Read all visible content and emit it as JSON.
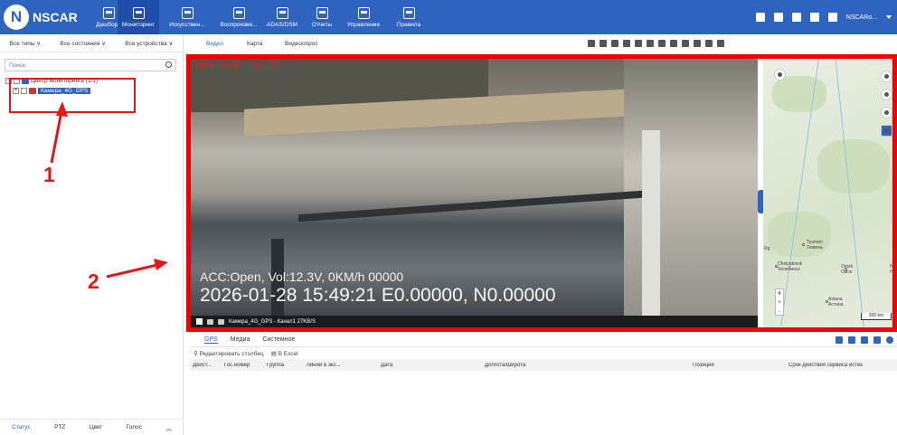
{
  "app": {
    "brand": "NSCAR",
    "logo_letter": "N"
  },
  "nav": [
    {
      "label": "Дашборд",
      "icon": "dashboard-icon"
    },
    {
      "label": "Мониторинг",
      "icon": "monitoring-icon",
      "active": true
    },
    {
      "label": "Искусствен...",
      "icon": "ai-icon"
    },
    {
      "label": "Воспроизве...",
      "icon": "playback-icon"
    },
    {
      "label": "ADAS/DSM",
      "icon": "adas-icon"
    },
    {
      "label": "Отчеты",
      "icon": "reports-icon"
    },
    {
      "label": "Управление",
      "icon": "management-icon"
    },
    {
      "label": "Правила",
      "icon": "rules-icon"
    }
  ],
  "topright": {
    "user": "NSCARo..."
  },
  "left": {
    "filters": [
      "Все типы ∨",
      "Все состояния ∨",
      "Все устройства ∨"
    ],
    "search_placeholder": "Поиск",
    "tree": {
      "root_label": "Центр мониторинга (1/1)",
      "root_toggle": "−",
      "device_label": "Камера_4G_GPS",
      "device_toggle": "+"
    },
    "bottom_tabs": [
      "Статус",
      "PTZ",
      "Цвет",
      "Голос"
    ]
  },
  "view_tabs": [
    "Видео",
    "Карта",
    "Видеоопрос"
  ],
  "video": {
    "rec_label": "Rec Exp: 1h 11",
    "osd_line1": "ACC:Open, Vol:12.3V, 0KM/h  00000",
    "osd_line2": "2026-01-28 15:49:21   E0.00000, N0.00000",
    "status_text": "Камера_4G_GPS - Канал1 27KB/S"
  },
  "map": {
    "cities": [
      {
        "name": "Tyumen",
        "sub": "Тюмень"
      },
      {
        "name": "Chelyabinsk",
        "sub": "Челябинск"
      },
      {
        "name": "Omsk",
        "sub": "Омск"
      },
      {
        "name": "Astana",
        "sub": "Астана"
      },
      {
        "name": "Rg",
        "sub": ""
      },
      {
        "name": "No",
        "sub": "Но"
      }
    ],
    "zoom_in": "+",
    "zoom_out": "-",
    "zoom_level": "4",
    "scale": "300 km"
  },
  "annotations": {
    "label1": "1",
    "label2": "2"
  },
  "bottom": {
    "tabs": [
      "GPS",
      "Медиа",
      "Системное"
    ],
    "edit_columns": "Редактировать столбец",
    "export_excel": "В Excel",
    "columns": [
      "Дейст...",
      "Гос.номер",
      "Группа",
      "Линии в экс...",
      "Дата",
      "Долгота/Широта",
      "Позиция",
      "Срок действия сервиса истек"
    ]
  }
}
